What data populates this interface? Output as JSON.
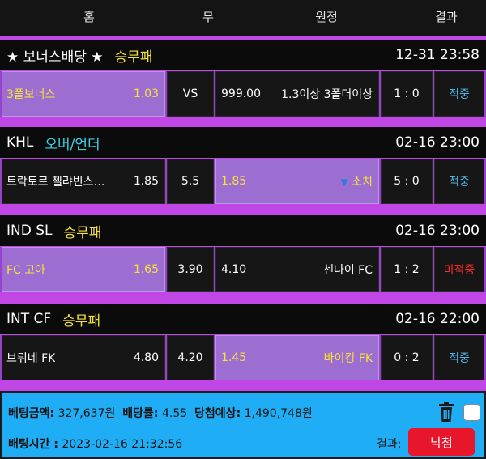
{
  "header": {
    "home": "홈",
    "draw": "무",
    "away": "원정",
    "result": "결과"
  },
  "groups": [
    {
      "league": "★ 보너스배당 ★",
      "market": "승무패",
      "time": "12-31 23:58",
      "home_name": "3폴보너스",
      "home_odds": "1.03",
      "draw": "VS",
      "away_odds": "999.00",
      "away_name": "1.3이상 3폴더이상",
      "score": "1 : 0",
      "result": "적중"
    },
    {
      "league": "KHL",
      "market": "오버/언더",
      "time": "02-16 23:00",
      "home_name": "트락토르 첼랴빈스…",
      "home_odds": "1.85",
      "draw": "5.5",
      "away_odds": "1.85",
      "away_arrow": "▼",
      "away_name": "소치",
      "score": "5 : 0",
      "result": "적중"
    },
    {
      "league": "IND SL",
      "market": "승무패",
      "time": "02-16 23:00",
      "home_name": "FC 고아",
      "home_odds": "1.65",
      "draw": "3.90",
      "away_odds": "4.10",
      "away_name": "첸나이 FC",
      "score": "1 : 2",
      "result": "미적중"
    },
    {
      "league": "INT CF",
      "market": "승무패",
      "time": "02-16 22:00",
      "home_name": "브뤼네 FK",
      "home_odds": "4.80",
      "draw": "4.20",
      "away_odds": "1.45",
      "away_name": "바이킹 FK",
      "score": "0 : 2",
      "result": "적중"
    }
  ],
  "bet": {
    "amount_label": "베팅금액:",
    "amount": "327,637원",
    "odds_label": "배당률:",
    "odds": "4.55",
    "win_label": "당첨예상:",
    "win": "1,490,748원",
    "time_label": "배팅시간 :",
    "time": "2023-02-16 21:32:56",
    "result_label": "결과:",
    "result": "낙첨"
  },
  "colors": {
    "accent_purple": "#c046e6",
    "selected": "#9d6ed2",
    "hit": "#4fb8ea",
    "miss": "#ff2b2b",
    "market": "#f5e23a",
    "panel": "#1faef5",
    "lose_button": "#e8162a"
  },
  "icons": {
    "delete": "trash-icon",
    "select": "checkbox-icon",
    "under": "down-triangle-icon"
  }
}
